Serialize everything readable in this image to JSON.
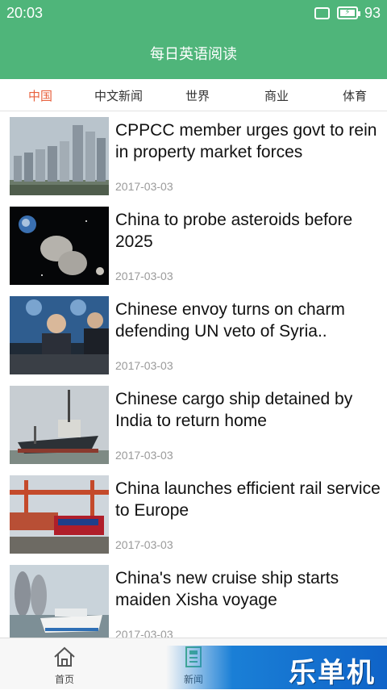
{
  "status_bar": {
    "time": "20:03",
    "battery_percent": "93"
  },
  "app_bar": {
    "title": "每日英语阅读"
  },
  "tabs": [
    {
      "label": "中国",
      "active": true
    },
    {
      "label": "中文新闻",
      "active": false
    },
    {
      "label": "世界",
      "active": false
    },
    {
      "label": "商业",
      "active": false
    },
    {
      "label": "体育",
      "active": false
    }
  ],
  "articles": [
    {
      "title": "CPPCC member urges govt to rein in property market forces",
      "date": "2017-03-03",
      "thumbnail": "city-skyline-image"
    },
    {
      "title": "China to probe asteroids before 2025",
      "date": "2017-03-03",
      "thumbnail": "asteroid-space-image"
    },
    {
      "title": "Chinese envoy turns on charm defending UN veto of Syria..",
      "date": "2017-03-03",
      "thumbnail": "un-meeting-image"
    },
    {
      "title": "Chinese cargo ship detained by India to return home",
      "date": "2017-03-03",
      "thumbnail": "cargo-ship-image"
    },
    {
      "title": "China launches efficient rail service to Europe",
      "date": "2017-03-03",
      "thumbnail": "freight-train-image"
    },
    {
      "title": "China's new cruise ship starts maiden Xisha voyage",
      "date": "2017-03-03",
      "thumbnail": "cruise-ship-image"
    }
  ],
  "bottom_nav": [
    {
      "label": "首页",
      "icon": "home-icon"
    },
    {
      "label": "新闻",
      "icon": "news-icon"
    }
  ],
  "watermark": {
    "text": "乐单机"
  },
  "colors": {
    "primary_green": "#4fb57a",
    "active_tab": "#e8603c",
    "date_gray": "#9a9a9a"
  }
}
